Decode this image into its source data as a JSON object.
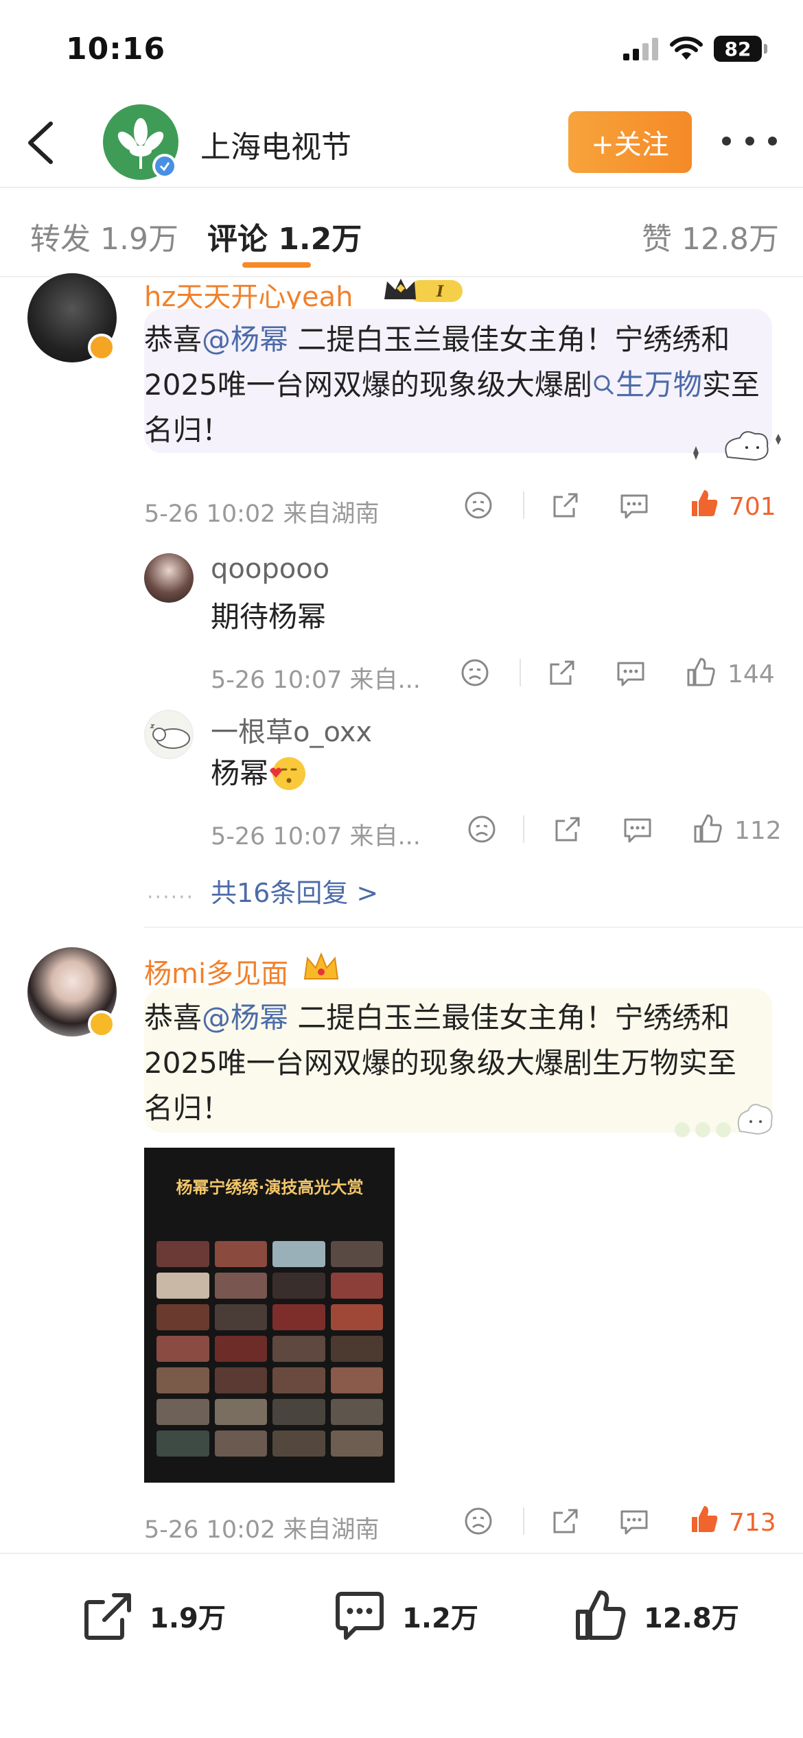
{
  "status_bar": {
    "time": "10:16",
    "battery": "82"
  },
  "nav": {
    "title": "上海电视节",
    "follow_label": "+关注"
  },
  "tabs": [
    {
      "label": "转发 1.9万"
    },
    {
      "label": "评论 1.2万"
    },
    {
      "label": "赞 12.8万"
    }
  ],
  "comments": [
    {
      "user": "hz天天开心yeah_",
      "text_pre": "恭喜",
      "mention": "@杨幂",
      "text_mid": " 二提白玉兰最佳女主角！宁绣绣和2025唯一台网双爆的现象级大爆剧",
      "topic": "生万物",
      "text_post": "实至名归！",
      "meta": "5-26 10:02  来自湖南",
      "likes": "701"
    },
    {
      "user": "杨mi多见面",
      "text_pre": "恭喜",
      "mention": "@杨幂",
      "text_mid": " 二提白玉兰最佳女主角！宁绣绣和2025唯一台网双爆的现象级大爆剧生万物实至名归！",
      "meta": "5-26 10:02  来自湖南",
      "likes": "713",
      "poster_title": "杨幂宁绣绣·演技高光大赏"
    }
  ],
  "replies": [
    {
      "user": "qoopooo",
      "text": "期待杨幂",
      "meta": "5-26 10:07  来自...",
      "likes": "144"
    },
    {
      "user": "一根草o_oxx",
      "text": "杨幂",
      "meta": "5-26 10:07  来自...",
      "likes": "112"
    }
  ],
  "more_replies_label": "共16条回复 >",
  "bottom_bar": {
    "repost": "1.9万",
    "comment": "1.2万",
    "like": "12.8万"
  },
  "colors": {
    "accent": "#f58a27",
    "link": "#4c6ba8",
    "hot": "#f0642d"
  }
}
